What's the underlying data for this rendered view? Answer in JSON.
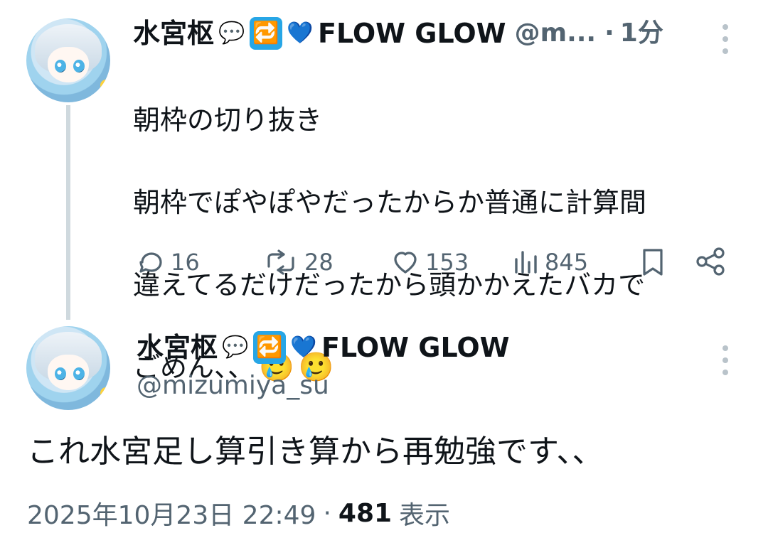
{
  "thread": {
    "first": {
      "display_name": "水宮枢",
      "badge_label": "FLOW GLOW",
      "handle": "@m...",
      "separator": "·",
      "time": "1分",
      "text_line1": "朝枠の切り抜き",
      "text_line2": "朝枠でぽやぽやだったからか普通に計算間",
      "text_line3": "違えてるだけだったから頭かかえたバカで",
      "text_line4": "ごめん、、",
      "emoji1": "🥲",
      "emoji2": "🥲",
      "counts": {
        "replies": "16",
        "reposts": "28",
        "likes": "153",
        "views": "845"
      }
    },
    "second": {
      "display_name": "水宮枢",
      "badge_label": "FLOW GLOW",
      "handle": "@mizumiya_su",
      "text": "これ水宮足し算引き算から再勉強です、、",
      "timestamp": "2025年10月23日 22:49",
      "dot": "·",
      "views": "481",
      "views_label": "表示"
    }
  },
  "icons": {
    "speech": "speech-bubble-icon",
    "repeat": "repeat-icon",
    "heart": "blue-heart-icon",
    "reply": "reply-icon",
    "repost": "repost-icon",
    "like": "like-icon",
    "views": "views-icon",
    "bookmark": "bookmark-icon",
    "share": "share-icon",
    "more": "more-icon"
  },
  "colors": {
    "text": "#0f1419",
    "secondary": "#536471",
    "line": "#cfd9de",
    "blue": "#1d9bf0"
  }
}
